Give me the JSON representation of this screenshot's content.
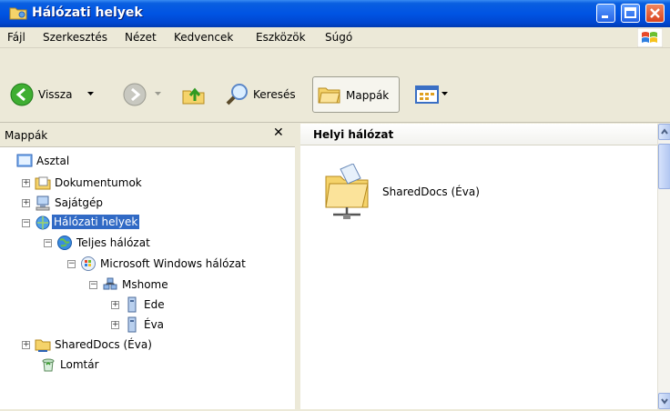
{
  "window": {
    "title": "Hálózati helyek"
  },
  "menu": {
    "items": [
      {
        "label": "Fájl"
      },
      {
        "label": "Szerkesztés"
      },
      {
        "label": "Nézet"
      },
      {
        "label": "Kedvencek"
      },
      {
        "label": "Eszközök"
      },
      {
        "label": "Súgó"
      }
    ]
  },
  "toolbar": {
    "back_label": "Vissza",
    "search_label": "Keresés",
    "folders_label": "Mappák"
  },
  "folders_pane": {
    "title": "Mappák",
    "close_glyph": "✕",
    "tree": [
      {
        "label": "Asztal"
      },
      {
        "label": "Dokumentumok"
      },
      {
        "label": "Sajátgép"
      },
      {
        "label": "Hálózati helyek",
        "selected": true
      },
      {
        "label": "Teljes hálózat"
      },
      {
        "label": "Microsoft Windows hálózat"
      },
      {
        "label": "Mshome"
      },
      {
        "label": "Ede"
      },
      {
        "label": "Éva"
      },
      {
        "label": "SharedDocs (Éva)"
      },
      {
        "label": "Lomtár"
      }
    ]
  },
  "content": {
    "group_header": "Helyi hálózat",
    "items": [
      {
        "label": "SharedDocs (Éva)"
      }
    ]
  },
  "colors": {
    "titlebar": "#0054e3",
    "selection": "#316ac5",
    "chrome": "#ece9d8"
  }
}
